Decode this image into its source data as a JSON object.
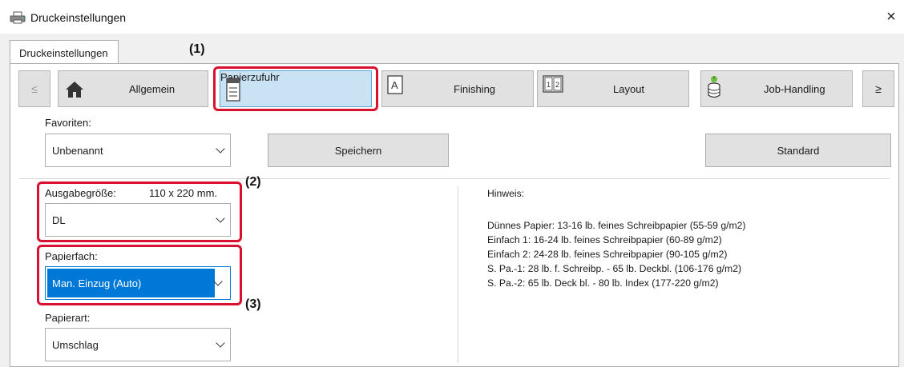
{
  "window": {
    "title": "Druckeinstellungen",
    "close_glyph": "×"
  },
  "tab": {
    "label": "Druckeinstellungen"
  },
  "toolbar": {
    "prev": "≤",
    "next": "≥",
    "items": [
      {
        "label": "Allgemein",
        "icon": "home-icon"
      },
      {
        "label": "Papierzufuhr",
        "icon": "paper-tray-icon",
        "selected": true
      },
      {
        "label": "Finishing",
        "icon": "finishing-icon"
      },
      {
        "label": "Layout",
        "icon": "layout-icon"
      },
      {
        "label": "Job-Handling",
        "icon": "job-handling-icon"
      }
    ]
  },
  "favorites": {
    "label": "Favoriten:",
    "value": "Unbenannt",
    "save_label": "Speichern",
    "standard_label": "Standard"
  },
  "output_size": {
    "label": "Ausgabegröße:",
    "dimension": "110 x 220 mm.",
    "value": "DL"
  },
  "paper_tray": {
    "label": "Papierfach:",
    "value": "Man. Einzug (Auto)"
  },
  "paper_type": {
    "label": "Papierart:",
    "value": "Umschlag"
  },
  "hint": {
    "title": "Hinweis:",
    "lines": [
      "Dünnes Papier: 13-16 lb. feines Schreibpapier (55-59 g/m2)",
      "Einfach 1: 16-24 lb. feines Schreibpapier (60-89 g/m2)",
      "Einfach 2: 24-28 lb. feines Schreibpapier (90-105 g/m2)",
      "S. Pa.-1: 28 lb. f. Schreibp. - 65 lb. Deckbl. (106-176 g/m2)",
      "S. Pa.-2: 65 lb. Deck bl. - 80 lb. Index (177-220 g/m2)"
    ]
  },
  "callouts": [
    "(1)",
    "(2)",
    "(3)"
  ],
  "colors": {
    "highlight": "#d9102f",
    "selection": "#0078d7",
    "selected_tab": "#c9e3f5"
  }
}
